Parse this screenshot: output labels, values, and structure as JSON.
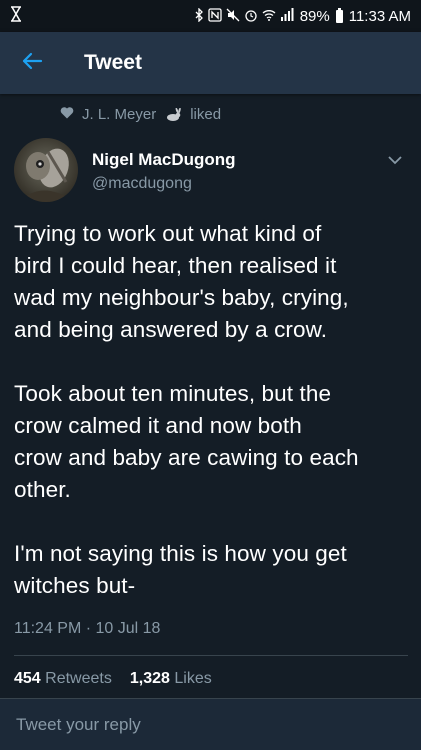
{
  "status_bar": {
    "left_icon": "notification-icon",
    "status_icons": [
      "bluetooth-icon",
      "nfc-icon",
      "mute-icon",
      "alarm-icon",
      "wifi-icon",
      "signal-icon"
    ],
    "battery": "89%",
    "time": "11:33 AM"
  },
  "app_bar": {
    "back_icon": "arrow-left-icon",
    "title": "Tweet"
  },
  "social_context": {
    "icon": "heart-icon",
    "name": "J. L. Meyer",
    "name_emoji": "rabbit-icon",
    "action": "liked"
  },
  "author": {
    "display_name": "Nigel MacDugong",
    "handle": "@macdugong"
  },
  "tweet": {
    "text": "Trying to work out what kind of\nbird I could hear, then realised it\nwad my neighbour's baby, crying,\nand being answered by a crow.\n\nTook about ten minutes, but the\ncrow calmed it and now both\ncrow and baby are cawing to each\nother.\n\nI'm not saying this is how you get\nwitches but-",
    "timestamp": "11:24 PM · 10 Jul 18",
    "retweets_count": "454",
    "retweets_label": "Retweets",
    "likes_count": "1,328",
    "likes_label": "Likes"
  },
  "reply": {
    "placeholder": "Tweet your reply"
  },
  "colors": {
    "background": "#141d26",
    "app_bar": "#243447",
    "accent": "#1da1f2",
    "secondary_text": "#8899a6"
  }
}
